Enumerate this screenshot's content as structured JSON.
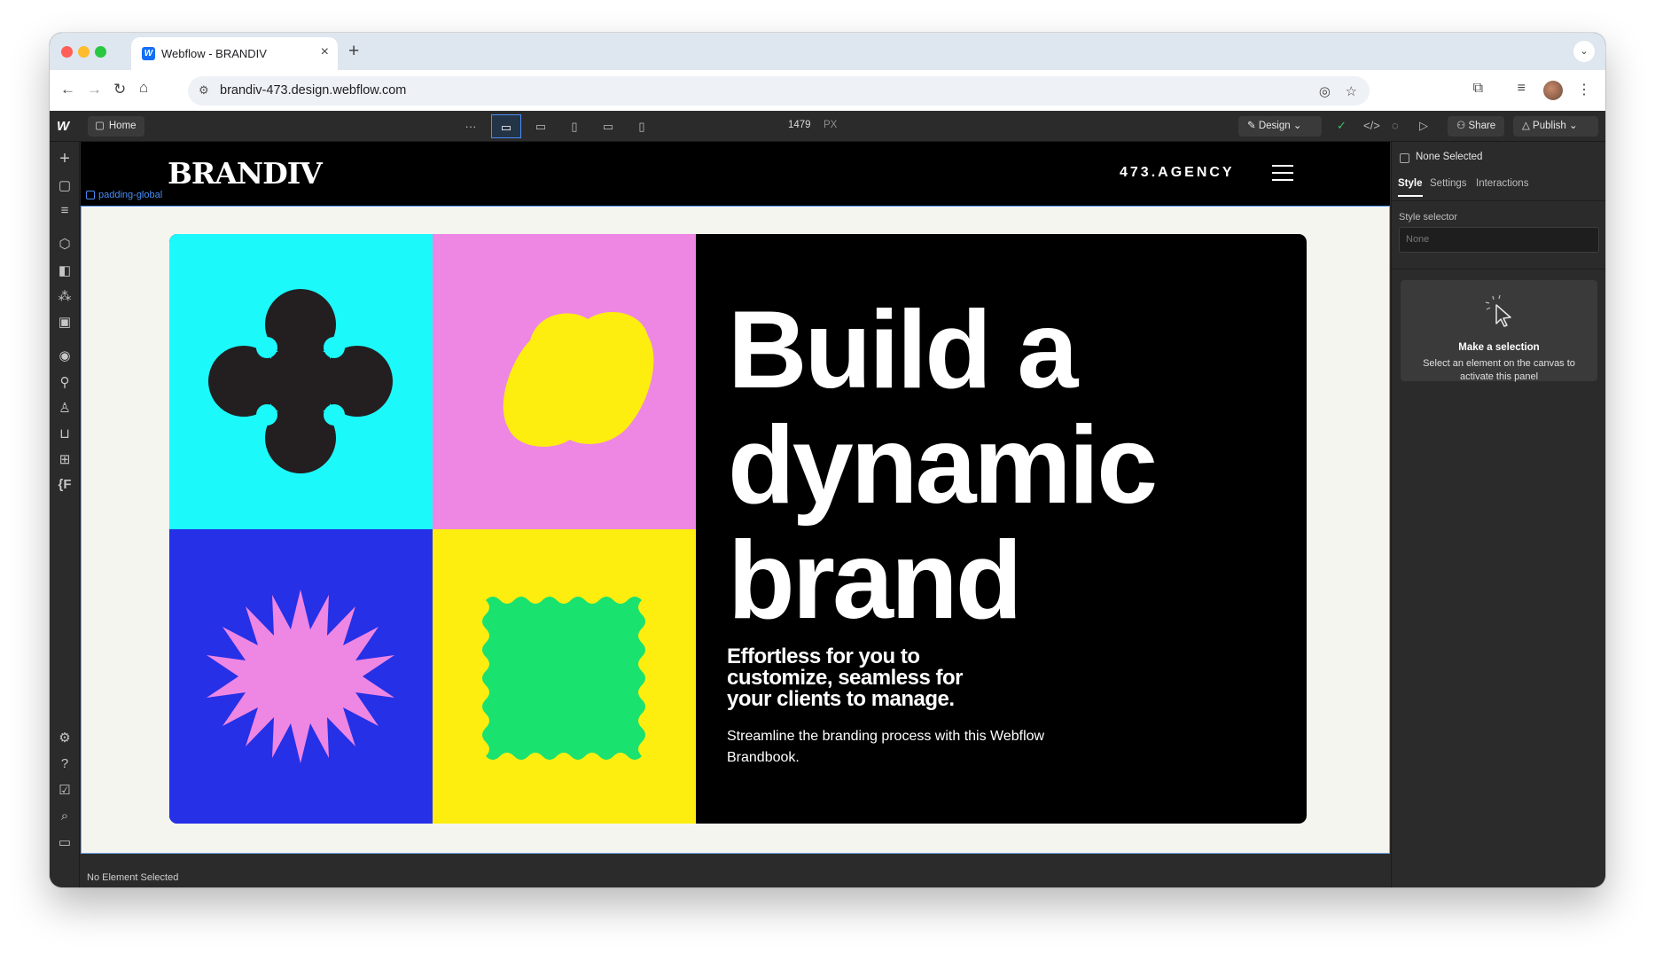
{
  "browser": {
    "tab_title": "Webflow - BRANDIV",
    "tab_close": "×",
    "new_tab": "+",
    "tab_menu": "⌄",
    "url": "brandiv-473.design.webflow.com",
    "favicon_letter": "W"
  },
  "webflow": {
    "page_name": "Home",
    "more": "···",
    "breakpoint_width": "1479",
    "breakpoint_unit": "PX",
    "mode_label": "Design",
    "share_label": "Share",
    "publish_label": "Publish"
  },
  "site": {
    "logo": "BRANDIV",
    "agency": "473.AGENCY",
    "selected_class": "padding-global",
    "hero_title_1": "Build a",
    "hero_title_2": "dynamic",
    "hero_title_3": "brand",
    "hero_subtitle": "Effortless for you to customize, seamless for your clients to manage.",
    "hero_body": "Streamline the branding process with this Webflow Brandbook.",
    "tiles": [
      "#1cf9fb",
      "#ee86e3",
      "#2630e6",
      "#fdee10"
    ]
  },
  "status_bar": {
    "text": "No Element Selected"
  },
  "right_panel": {
    "none_selected": "None Selected",
    "tabs": [
      "Style",
      "Settings",
      "Interactions"
    ],
    "style_selector_label": "Style selector",
    "style_selector_value": "None",
    "empty_title": "Make a selection",
    "empty_text": "Select an element on the canvas to activate this panel"
  },
  "colors": {
    "accent": "#4a8df6",
    "editor_bg": "#2b2b2b",
    "canvas_bg": "#f5f5f0"
  }
}
